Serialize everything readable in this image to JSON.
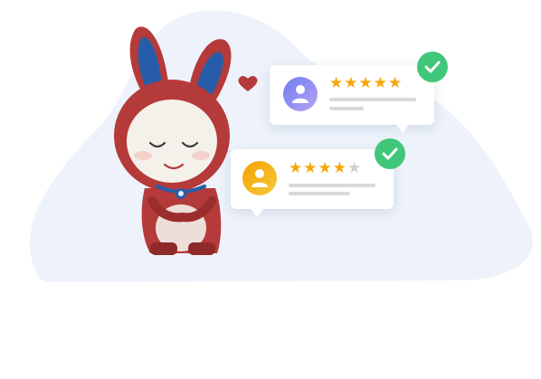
{
  "colors": {
    "background_blob": "#eef3fb",
    "mascot_red": "#b53a3a",
    "mascot_face": "#f4f1ea",
    "ear_inner": "#275da8",
    "heart": "#b53a3a",
    "star_filled": "#f6a609",
    "star_empty": "#cfcfcf",
    "check_green": "#41c77a",
    "avatar_1": "#7b84f0",
    "avatar_2": "#f4ac14",
    "text_line": "#d9d9d9"
  },
  "reviews": [
    {
      "rating": 5,
      "max": 5,
      "avatar_icon": "user-icon",
      "verified_icon": "checkmark-icon"
    },
    {
      "rating": 4,
      "max": 5,
      "avatar_icon": "user-icon",
      "verified_icon": "checkmark-icon"
    }
  ],
  "icons": {
    "heart": "heart-icon",
    "mascot": "bunny-mascot-illustration"
  }
}
